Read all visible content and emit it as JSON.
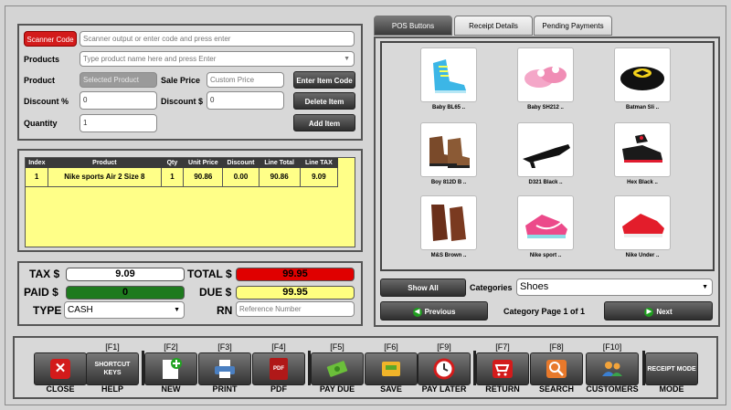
{
  "form": {
    "scanner_label": "Scanner Code",
    "scanner_placeholder": "Scanner output or enter code and press enter",
    "products_label": "Products",
    "products_placeholder": "Type product name here and press Enter",
    "product_label": "Product",
    "product_placeholder": "Selected Product",
    "sale_price_label": "Sale Price",
    "sale_price_placeholder": "Custom Price",
    "enter_item_code": "Enter Item Code",
    "discount_pct_label": "Discount %",
    "discount_pct_value": "0",
    "discount_amt_label": "Discount $",
    "discount_amt_value": "0",
    "delete_item": "Delete Item",
    "quantity_label": "Quantity",
    "quantity_value": "1",
    "add_item": "Add Item"
  },
  "cart": {
    "headers": [
      "Index",
      "Product",
      "Qty",
      "Unit Price",
      "Discount",
      "Line Total",
      "Line TAX"
    ],
    "rows": [
      [
        "1",
        "Nike sports Air 2 Size 8",
        "1",
        "90.86",
        "0.00",
        "90.86",
        "9.09"
      ]
    ]
  },
  "totals": {
    "tax_label": "TAX $",
    "tax_value": "9.09",
    "total_label": "TOTAL $",
    "total_value": "99.95",
    "paid_label": "PAID $",
    "paid_value": "0",
    "due_label": "DUE $",
    "due_value": "99.95",
    "type_label": "TYPE",
    "type_value": "CASH",
    "rn_label": "RN",
    "rn_placeholder": "Reference Number",
    "colors": {
      "total": "#e00000",
      "paid": "#1e7a1e",
      "due": "#ffff80"
    }
  },
  "tabs": [
    "POS Buttons",
    "Receipt Details",
    "Pending Payments"
  ],
  "products": [
    {
      "name": "Baby BL65 ..",
      "icon": "blue-baby-shoe"
    },
    {
      "name": "Baby SH212 ..",
      "icon": "pink-baby-shoe"
    },
    {
      "name": "Batman Sli ..",
      "icon": "batman-slipper"
    },
    {
      "name": "Boy 812D B ..",
      "icon": "brown-boot"
    },
    {
      "name": "D321 Black ..",
      "icon": "black-heel"
    },
    {
      "name": "Hex Black ..",
      "icon": "black-sneaker"
    },
    {
      "name": "M&S Brown ..",
      "icon": "brown-dress-shoe"
    },
    {
      "name": "Nike sport ..",
      "icon": "pink-nike-sneaker"
    },
    {
      "name": "Nike Under ..",
      "icon": "red-sneaker"
    }
  ],
  "browse": {
    "show_all": "Show All",
    "categories_label": "Categories",
    "category_value": "Shoes",
    "previous": "Previous",
    "page_text": "Category Page 1 of 1",
    "next": "Next"
  },
  "toolbar": [
    {
      "key": "",
      "label": "CLOSE",
      "icon": "close-icon"
    },
    {
      "key": "[F1]",
      "label": "HELP",
      "text": "SHORTCUT KEYS"
    },
    {
      "key": "[F2]",
      "label": "NEW",
      "icon": "new-document-icon"
    },
    {
      "key": "[F3]",
      "label": "PRINT",
      "icon": "printer-icon"
    },
    {
      "key": "[F4]",
      "label": "PDF",
      "icon": "pdf-icon"
    },
    {
      "key": "[F5]",
      "label": "PAY DUE",
      "icon": "pay-money-icon"
    },
    {
      "key": "[F6]",
      "label": "SAVE",
      "icon": "save-icon"
    },
    {
      "key": "[F9]",
      "label": "PAY LATER",
      "icon": "pay-later-icon"
    },
    {
      "key": "[F7]",
      "label": "RETURN",
      "icon": "return-cart-icon"
    },
    {
      "key": "[F8]",
      "label": "SEARCH",
      "icon": "search-icon"
    },
    {
      "key": "[F10]",
      "label": "CUSTOMERS",
      "icon": "customers-icon"
    },
    {
      "key": "",
      "label": "MODE",
      "text": "RECEIPT MODE"
    }
  ]
}
